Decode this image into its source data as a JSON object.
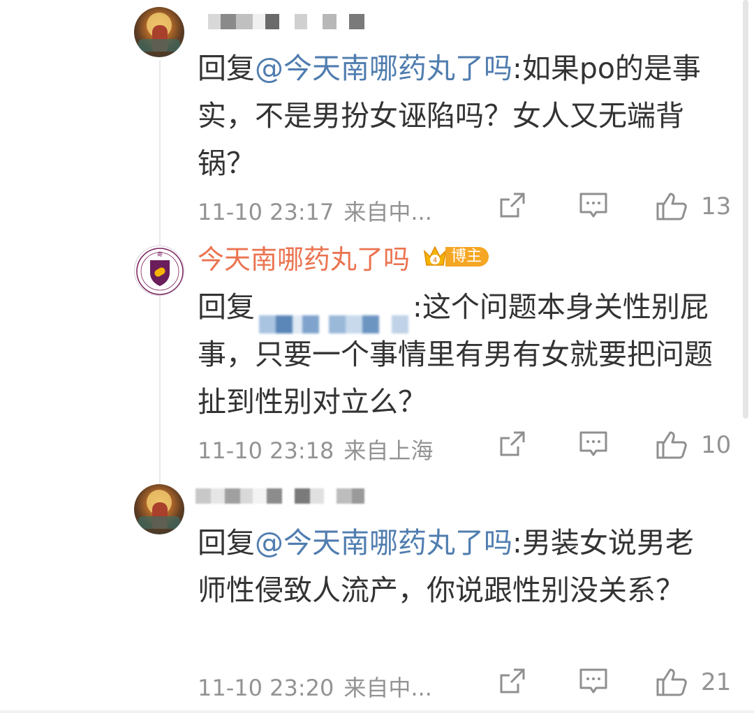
{
  "comments": [
    {
      "username": "",
      "reply_prefix": "回复",
      "reply_to": "@今天南哪药丸了吗",
      "reply_text": ":如果po的是事实，不是男扮女诬陷吗？女人又无端背锅？",
      "time": "11-10 23:17",
      "location": "来自中...",
      "likes": "13",
      "avatar_icon": "deity-painting-avatar"
    },
    {
      "username": "今天南哪药丸了吗",
      "badge_label": "博主",
      "reply_prefix": "回复",
      "reply_to": "",
      "reply_text": ":这个问题本身关性别屁事，只要一个事情里有男有女就要把问题扯到性别对立么？",
      "time": "11-10 23:18",
      "location": "来自上海",
      "likes": "10",
      "avatar_icon": "university-seal-avatar"
    },
    {
      "username": "",
      "reply_prefix": "回复",
      "reply_to": "@今天南哪药丸了吗",
      "reply_text": ":男装女说男老师性侵致人流产，你说跟性别没关系？",
      "time": "11-10 23:20",
      "location": "来自中...",
      "likes": "21",
      "avatar_icon": "deity-painting-avatar"
    }
  ],
  "colors": {
    "mention": "#507daf",
    "username": "#eb7350",
    "meta": "#939393",
    "badge": "#f5a623"
  },
  "icons": [
    "share-icon",
    "comment-icon",
    "like-icon",
    "crown-badge-icon"
  ]
}
